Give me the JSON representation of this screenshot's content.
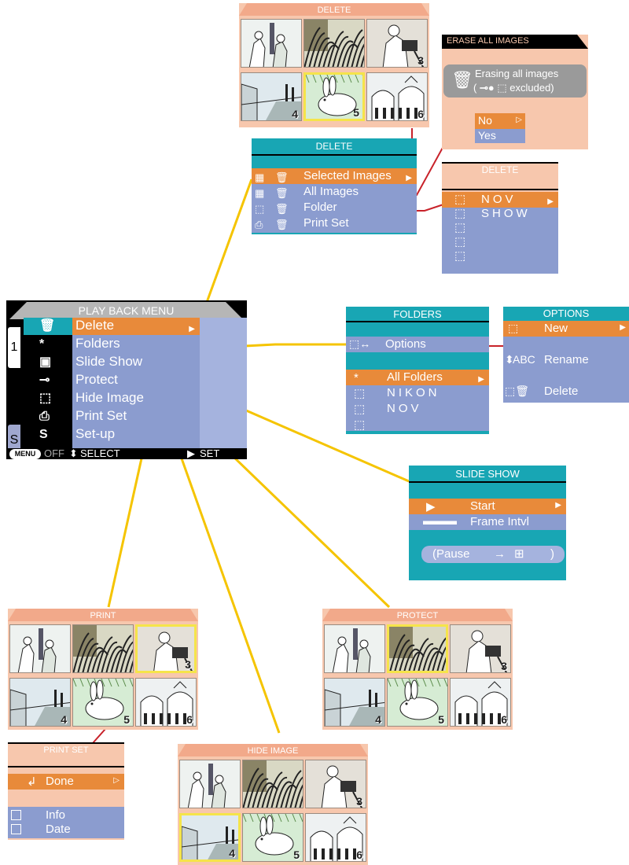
{
  "playback_menu": {
    "title": "PLAY BACK MENU",
    "tab_top": "1",
    "tab_bottom": "S",
    "items": [
      {
        "label": "Delete",
        "icon": "trash-icon",
        "glyph": "🗑"
      },
      {
        "label": "Folders",
        "icon": "asterisk-icon",
        "glyph": "*"
      },
      {
        "label": "Slide Show",
        "icon": "slideshow-icon",
        "glyph": "▣"
      },
      {
        "label": "Protect",
        "icon": "key-icon",
        "glyph": "⊸"
      },
      {
        "label": "Hide Image",
        "icon": "hide-image-icon",
        "glyph": "⬚"
      },
      {
        "label": "Print Set",
        "icon": "printer-icon",
        "glyph": "⎙"
      },
      {
        "label": "Set-up",
        "icon": "setup-icon",
        "glyph": "S"
      }
    ],
    "footer": {
      "menu": "MENU",
      "off": "OFF",
      "select": "SELECT",
      "set": "SET"
    }
  },
  "delete_menu": {
    "title": "DELETE",
    "items": [
      "Selected Images",
      "All Images",
      "Folder",
      "Print Set"
    ]
  },
  "delete_thumbs": {
    "title": "DELETE",
    "numbers": [
      "",
      "",
      "3",
      "4",
      "5",
      "6"
    ]
  },
  "erase_all": {
    "title": "ERASE ALL IMAGES",
    "message_line1": "Erasing all images",
    "message_line2_open": "(",
    "message_line2_close": "excluded)",
    "options": [
      "No",
      "Yes"
    ]
  },
  "delete_folder": {
    "title": "DELETE",
    "items": [
      "NOV",
      "SHOW"
    ]
  },
  "folders": {
    "title": "FOLDERS",
    "options_label": "Options",
    "items": [
      "All Folders",
      "NIKON",
      "NOV"
    ]
  },
  "options": {
    "title": "OPTIONS",
    "items": [
      "New",
      "Rename",
      "Delete"
    ],
    "rename_prefix": "ABC"
  },
  "slide_show": {
    "title": "SLIDE SHOW",
    "items": [
      "Start",
      "Frame Intvl"
    ],
    "pause_label": "(Pause",
    "pause_end": ")"
  },
  "print_thumbs": {
    "title": "PRINT",
    "numbers": [
      "",
      "",
      "3",
      "4",
      "5",
      "6"
    ]
  },
  "protect_thumbs": {
    "title": "PROTECT",
    "numbers": [
      "",
      "",
      "3",
      "4",
      "5",
      "6"
    ]
  },
  "hide_thumbs": {
    "title": "HIDE IMAGE",
    "numbers": [
      "",
      "",
      "3",
      "4",
      "5",
      "6"
    ]
  },
  "print_set": {
    "title": "PRINT SET",
    "done": "Done",
    "items": [
      "Info",
      "Date"
    ]
  },
  "colors": {
    "orange": "#e88a3a",
    "blue": "#8b9ccf",
    "teal": "#18a6b4",
    "peach": "#f7c7ad",
    "yellow": "#f5c400",
    "red": "#c8222a"
  }
}
